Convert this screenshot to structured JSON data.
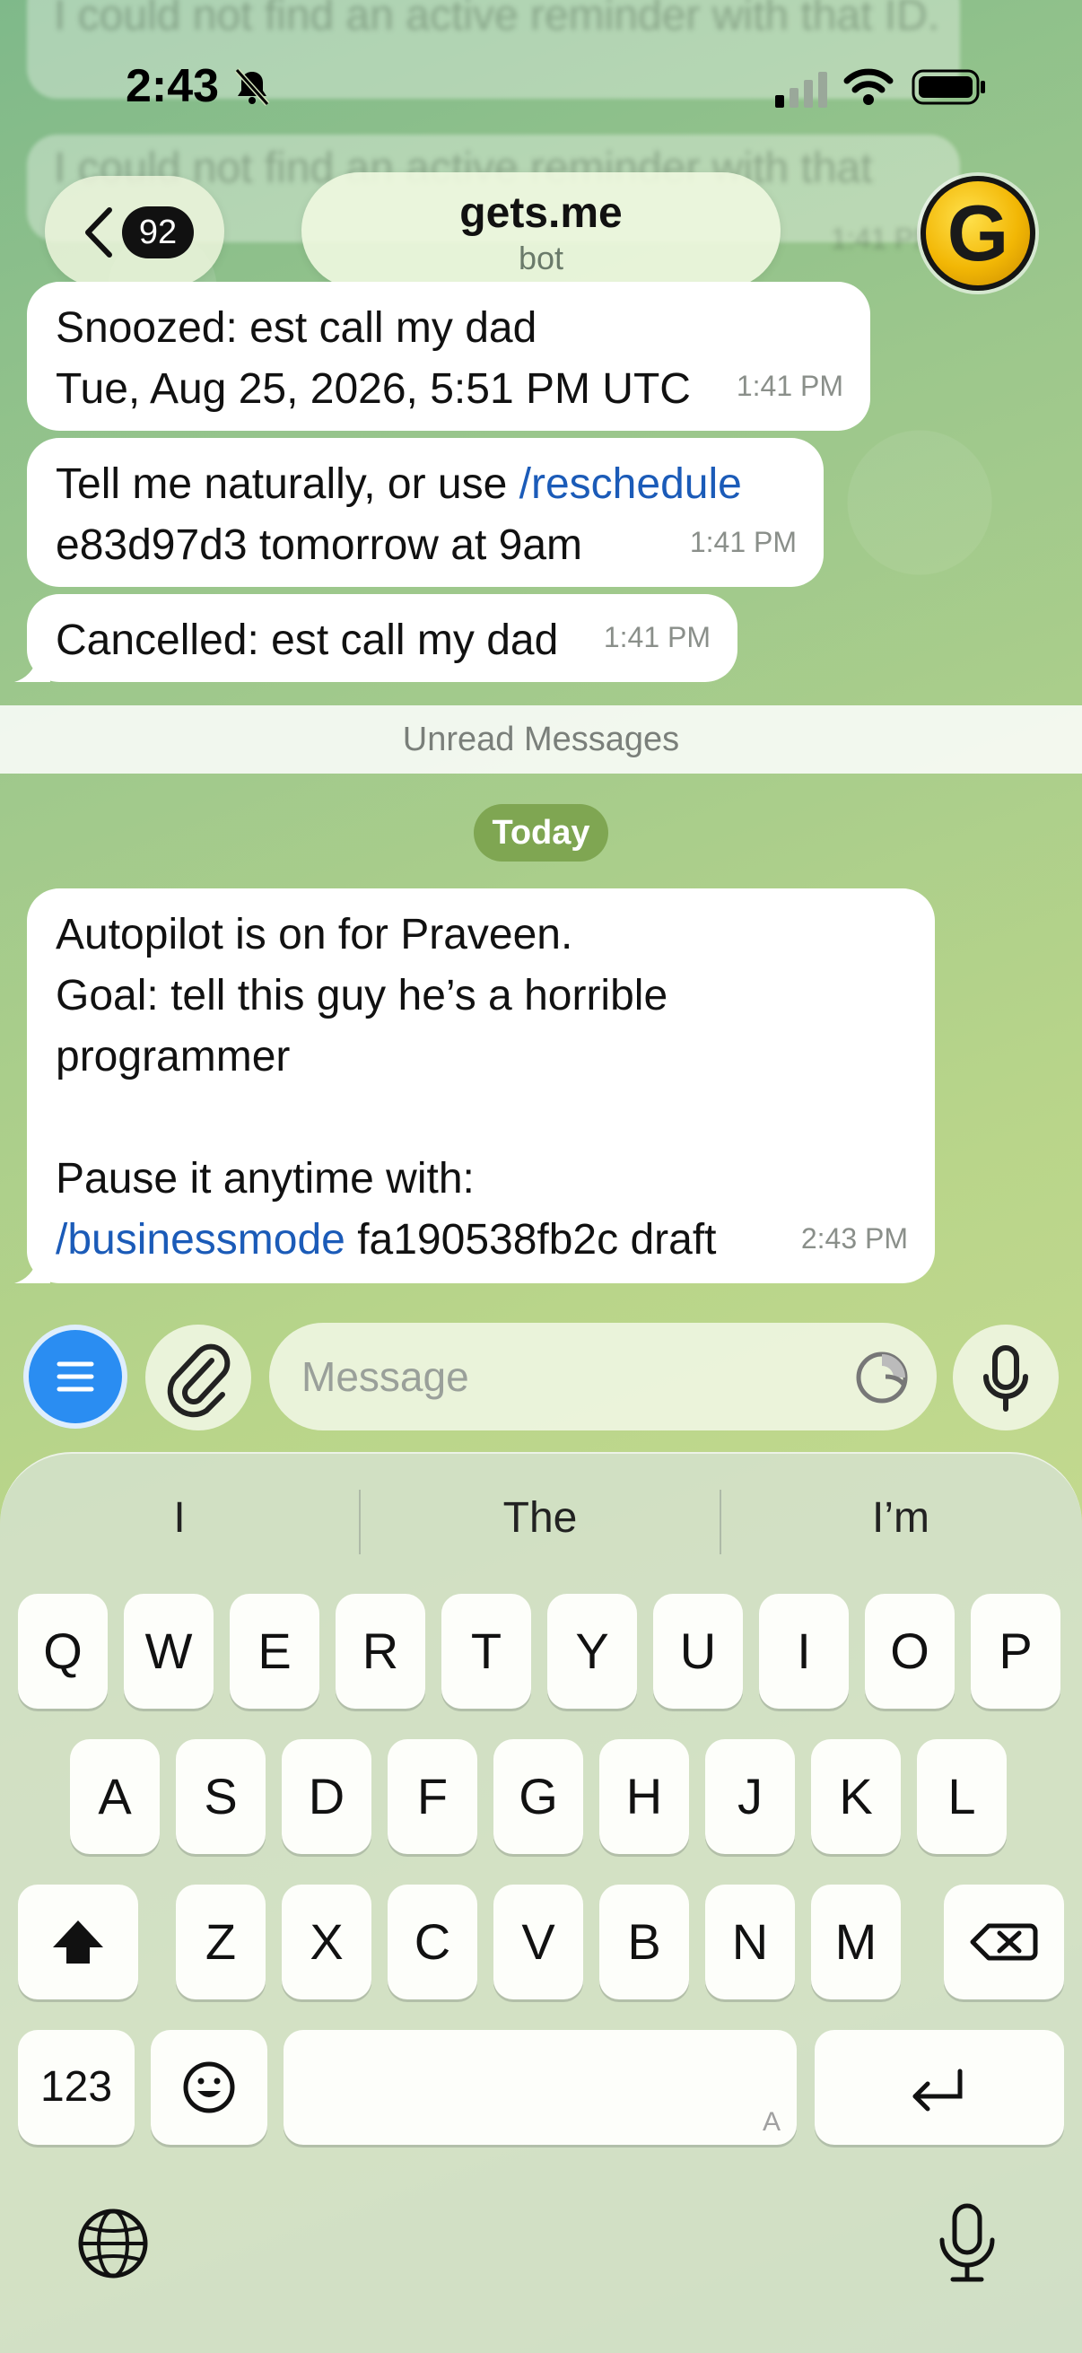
{
  "status_bar": {
    "time": "2:43"
  },
  "ghost": {
    "line1": "I could not find an active reminder with that ID.",
    "line2": "I could not find an active reminder with that",
    "time": "1:41 PM"
  },
  "header": {
    "back_count": "92",
    "title": "gets.me",
    "subtitle": "bot",
    "avatar_letter": "G"
  },
  "messages": [
    {
      "line1": "Snoozed: est call my dad",
      "line2": "Tue, Aug 25, 2026, 5:51 PM UTC",
      "time": "1:41 PM"
    },
    {
      "line1_prefix": "Tell me naturally, or use ",
      "line1_cmd": "/reschedule",
      "line2": "e83d97d3 tomorrow at 9am",
      "time": "1:41 PM"
    },
    {
      "text": "Cancelled: est call my dad",
      "time": "1:41 PM"
    }
  ],
  "unread_label": "Unread Messages",
  "date_chip": "Today",
  "autopilot_message": {
    "line1": "Autopilot is on for Praveen.",
    "line2": "Goal: tell this guy he’s a horrible",
    "line3": "programmer",
    "line4": "Pause it anytime with:",
    "cmd": "/businessmode",
    "cmd_rest": " fa190538fb2c draft",
    "time": "2:43 PM"
  },
  "input": {
    "placeholder": "Message"
  },
  "keyboard": {
    "suggestions": [
      "I",
      "The",
      "I’m"
    ],
    "row1": [
      "Q",
      "W",
      "E",
      "R",
      "T",
      "Y",
      "U",
      "I",
      "O",
      "P"
    ],
    "row2": [
      "A",
      "S",
      "D",
      "F",
      "G",
      "H",
      "J",
      "K",
      "L"
    ],
    "row3": [
      "Z",
      "X",
      "C",
      "V",
      "B",
      "N",
      "M"
    ],
    "numbers_key": "123",
    "space_hint": "A"
  },
  "colors": {
    "accent_blue": "#2a8df2",
    "command_link": "#1b5bb8",
    "date_chip": "#7fa652"
  }
}
